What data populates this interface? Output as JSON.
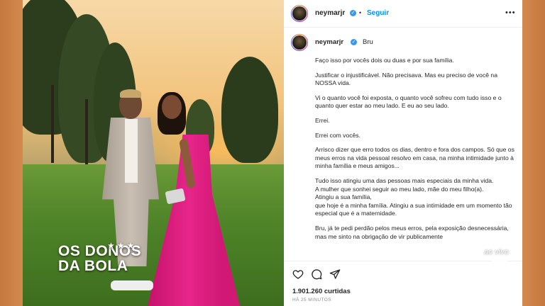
{
  "post": {
    "username": "neymarjr",
    "follow_label": "Seguir",
    "caption_first_word": "Bru",
    "paragraphs": [
      "Faço isso por vocês dois ou duas e por sua família.",
      "Justificar o injustificável. Não precisava. Mas eu preciso de você na NOSSA vida.",
      "Vi o quanto você foi exposta, o quanto você sofreu com tudo isso e o quanto quer estar ao meu lado. E eu ao seu lado.",
      "Errei.",
      "Errei com vocês.",
      "Arrisco dizer que erro todos os dias, dentro e fora dos campos. Só que os meus erros na vida pessoal resolvo em casa, na minha intimidade junto à minha família e meus amigos...",
      "Tudo isso atingiu uma das pessoas mais especiais da minha vida.\nA mulher que sonhei seguir ao meu lado, mãe do meu filho(a).\nAtingiu a sua família,\nque hoje é a minha família. Atingiu a sua intimidade em um momento tão especial que é a maternidade.",
      "Bru, já te pedi perdão pelos meus erros, pela exposição desnecessária, mas me sinto na obrigação de vir publicamente"
    ],
    "likes": "1.901.260 curtidas",
    "time": "HÁ 25 MINUTOS"
  },
  "show": {
    "logo_line1": "OS DONOS",
    "logo_line2": "DA BOLA",
    "stars": "★ ★ ★"
  },
  "watermark": {
    "label": "ao vivo",
    "icon": "band-eye-logo"
  },
  "icons": {
    "like": "heart-icon",
    "comment": "comment-icon",
    "share": "paper-plane-icon",
    "more": "more-options-icon",
    "verified": "verified-badge-icon"
  },
  "colors": {
    "follow": "#0095f6",
    "verified": "#3897f0",
    "dress": "#e7258a",
    "frame": "#c4773e"
  }
}
